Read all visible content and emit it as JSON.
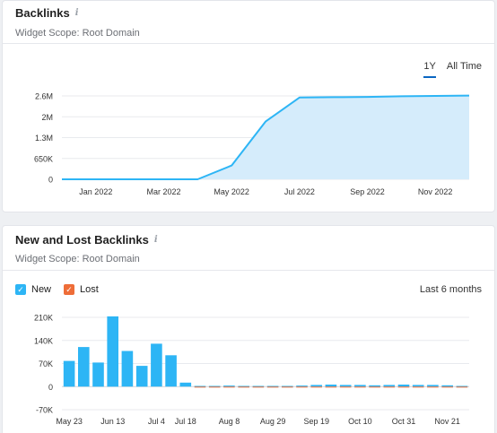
{
  "backlinks_widget": {
    "title": "Backlinks",
    "scope": "Widget Scope: Root Domain",
    "tabs": [
      {
        "label": "1Y",
        "active": true
      },
      {
        "label": "All Time",
        "active": false
      }
    ]
  },
  "new_lost_widget": {
    "title": "New and Lost Backlinks",
    "scope": "Widget Scope: Root Domain",
    "legend": [
      {
        "label": "New",
        "color": "#2db5f5"
      },
      {
        "label": "Lost",
        "color": "#ee6d38"
      }
    ],
    "period": "Last 6 months"
  },
  "chart_data": [
    {
      "type": "area",
      "ylim": [
        0,
        2600000
      ],
      "yticks": [
        "0",
        "650K",
        "1.3M",
        "2M",
        "2.6M"
      ],
      "ytick_values": [
        0,
        650000,
        1300000,
        1950000,
        2600000
      ],
      "xticks": [
        "Jan 2022",
        "Mar 2022",
        "May 2022",
        "Jul 2022",
        "Sep 2022",
        "Nov 2022"
      ],
      "color": "#2db5f5",
      "fill": "#d5ecfb",
      "series": [
        {
          "x": [
            "2021-12",
            "2022-01",
            "2022-02",
            "2022-03",
            "2022-04",
            "2022-05",
            "2022-06",
            "2022-07",
            "2022-08",
            "2022-09",
            "2022-10",
            "2022-11",
            "2022-12"
          ],
          "values": [
            0,
            0,
            0,
            0,
            0,
            430000,
            1800000,
            2550000,
            2560000,
            2570000,
            2590000,
            2600000,
            2610000
          ]
        }
      ]
    },
    {
      "type": "bar",
      "ylim": [
        -70000,
        210000
      ],
      "yticks": [
        "-70K",
        "0",
        "70K",
        "140K",
        "210K"
      ],
      "ytick_values": [
        -70000,
        0,
        70000,
        140000,
        210000
      ],
      "xticks": [
        "May 23",
        "Jun 13",
        "Jul 4",
        "Jul 18",
        "Aug 8",
        "Aug 29",
        "Sep 19",
        "Oct 10",
        "Oct 31",
        "Nov 21"
      ],
      "series": [
        {
          "name": "New",
          "color": "#2db5f5",
          "values": [
            78000,
            120000,
            73000,
            213000,
            108000,
            63000,
            130000,
            95000,
            12000,
            2000,
            2000,
            3000,
            2000,
            2000,
            2000,
            2000,
            3000,
            5000,
            6000,
            5000,
            5000,
            4000,
            5000,
            6000,
            5000,
            5000,
            4000,
            2000
          ]
        },
        {
          "name": "Lost",
          "color": "#ee6d38",
          "values": [
            0,
            0,
            0,
            0,
            0,
            0,
            0,
            0,
            0,
            -2000,
            -2000,
            -2000,
            -2000,
            -2000,
            -2000,
            -1500,
            -1000,
            -1000,
            -1000,
            -1000,
            -1000,
            -1000,
            -1000,
            -1000,
            -1000,
            -1000,
            -1000,
            -1000
          ]
        }
      ]
    }
  ]
}
